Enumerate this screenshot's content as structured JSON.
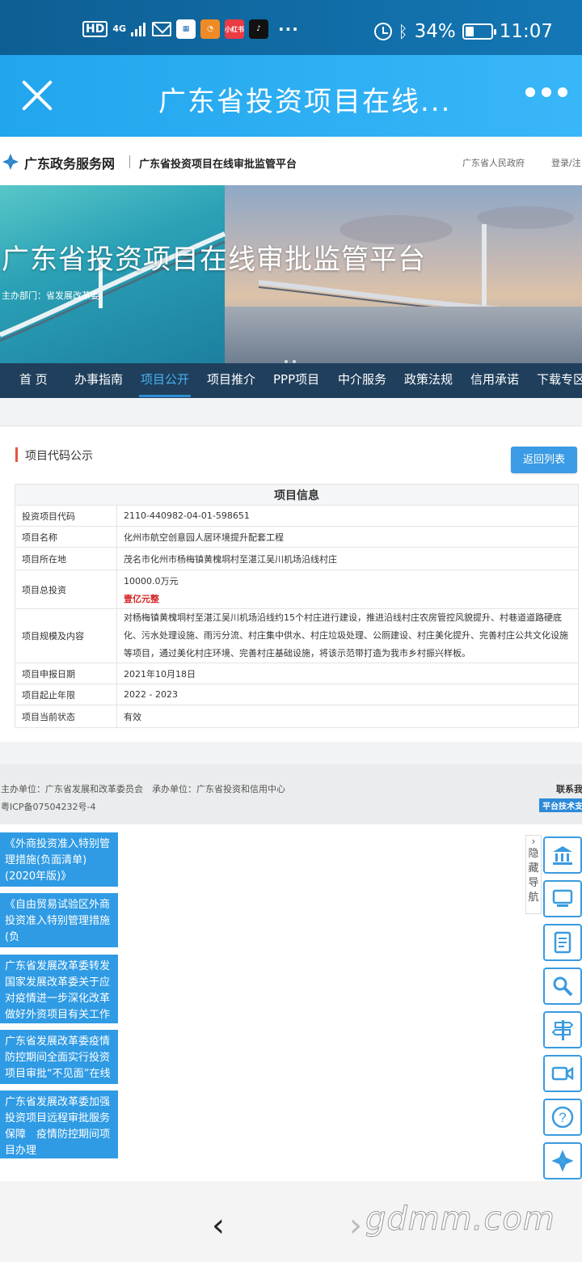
{
  "status_bar": {
    "hd": "HD",
    "network": "4G",
    "app_badges": [
      "小红书"
    ],
    "more": "···",
    "battery": "34%",
    "battery_level": 0.34,
    "time": "11:07"
  },
  "titlebar": {
    "title": "广东省投资项目在线..."
  },
  "site_header": {
    "site_name": "广东政务服务网",
    "platform_name": "广东省投资项目在线审批监管平台",
    "gov_link": "广东省人民政府",
    "login": "登录/注"
  },
  "banner": {
    "title": "广东省投资项目在线审批监管平台",
    "subtitle": "主办部门：省发展改革委"
  },
  "nav": {
    "items": [
      {
        "label": "首 页"
      },
      {
        "label": "办事指南"
      },
      {
        "label": "项目公开"
      },
      {
        "label": "项目推介"
      },
      {
        "label": "PPP项目"
      },
      {
        "label": "中介服务"
      },
      {
        "label": "政策法规"
      },
      {
        "label": "信用承诺"
      },
      {
        "label": "下载专区"
      }
    ],
    "active_index": 2
  },
  "content": {
    "section_title": "项目代码公示",
    "back_button": "返回列表",
    "table_title": "项目信息",
    "rows": [
      {
        "label": "投资项目代码",
        "value": "2110-440982-04-01-598651"
      },
      {
        "label": "项目名称",
        "value": "化州市航空创意园人居环境提升配套工程"
      },
      {
        "label": "项目所在地",
        "value": "茂名市化州市杨梅镇黄槐垌村至湛江吴川机场沿线村庄"
      },
      {
        "label": "项目总投资",
        "value": "10000.0万元",
        "extra": "壹亿元整"
      },
      {
        "label": "项目规模及内容",
        "value": "对杨梅镇黄槐垌村至湛江吴川机场沿线约15个村庄进行建设，推进沿线村庄农房管控风貌提升、村巷道道路硬底化、污水处理设施、雨污分流、村庄集中供水、村庄垃圾处理、公厕建设、村庄美化提升、完善村庄公共文化设施等项目，通过美化村庄环境、完善村庄基础设施，将该示范带打造为我市乡村振兴样板。"
      },
      {
        "label": "项目申报日期",
        "value": "2021年10月18日"
      },
      {
        "label": "项目起止年限",
        "value": "2022 - 2023"
      },
      {
        "label": "项目当前状态",
        "value": "有效"
      }
    ]
  },
  "footer": {
    "line1": "主办单位：广东省发展和改革委员会　承办单位：广东省投资和信用中心",
    "line2": "粤ICP备07504232号-4",
    "contact": "联系我",
    "tech_support": "平台技术支"
  },
  "notices": [
    "《外商投资准入特别管理措施(负面清单)(2020年版)》",
    "《自由贸易试验区外商投资准入特别管理措施(负",
    "广东省发展改革委转发国家发展改革委关于应对疫情进一步深化改革做好外资项目有关工作",
    "广东省发展改革委疫情防控期间全面实行投资项目审批“不见面”在线",
    "广东省发展改革委加强投资项目远程审批服务保障　疫情防控期间项目办理"
  ],
  "side_toolbar": {
    "hide_label": "隐藏导航",
    "tools": [
      "bank-icon",
      "computer-icon",
      "document-icon",
      "search-icon",
      "signpost-icon",
      "video-icon",
      "help-icon",
      "logo-icon"
    ]
  },
  "bottom_bar": {
    "back": "‹",
    "forward": "›",
    "watermark": "gdmm.com"
  },
  "colors": {
    "accent": "#3b9be4",
    "nav_bg": "#1f3f5c",
    "titlebar": "#2aaef4",
    "amount_red": "#d42323"
  }
}
